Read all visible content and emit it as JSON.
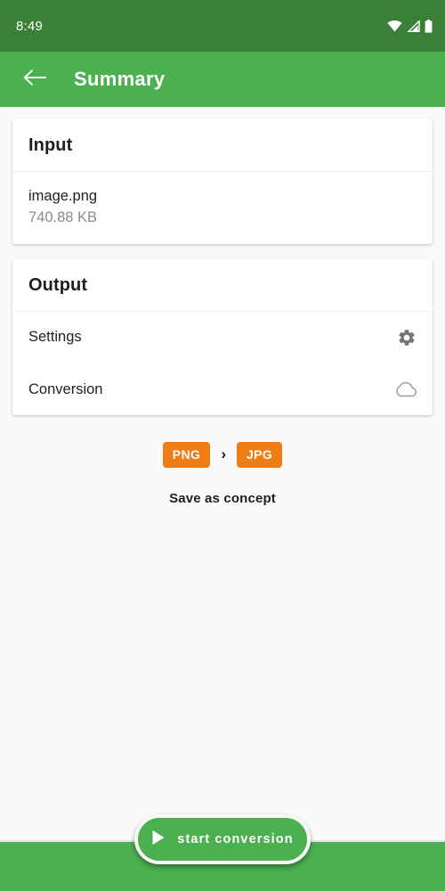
{
  "status_bar": {
    "time": "8:49",
    "icons": [
      "wifi-icon",
      "cellular-signal-icon",
      "battery-icon"
    ]
  },
  "app_bar": {
    "back_icon": "arrow-left-icon",
    "title": "Summary"
  },
  "input_card": {
    "header": "Input",
    "file_name": "image.png",
    "file_size": "740.88 KB"
  },
  "output_card": {
    "header": "Output",
    "rows": [
      {
        "label": "Settings",
        "icon": "gear-icon"
      },
      {
        "label": "Conversion",
        "icon": "cloud-icon"
      }
    ]
  },
  "conversion": {
    "source_format": "PNG",
    "separator": "›",
    "target_format": "JPG",
    "save_as_concept": "Save as concept"
  },
  "fab": {
    "icon": "play-icon",
    "label": "start conversion"
  },
  "colors": {
    "status_bar": "#3a8039",
    "app_bar": "#4caf50",
    "accent_orange": "#f07c16",
    "background": "#fafafa",
    "card": "#ffffff",
    "icon_gray": "#757575",
    "muted_text": "#8a8a8a"
  }
}
